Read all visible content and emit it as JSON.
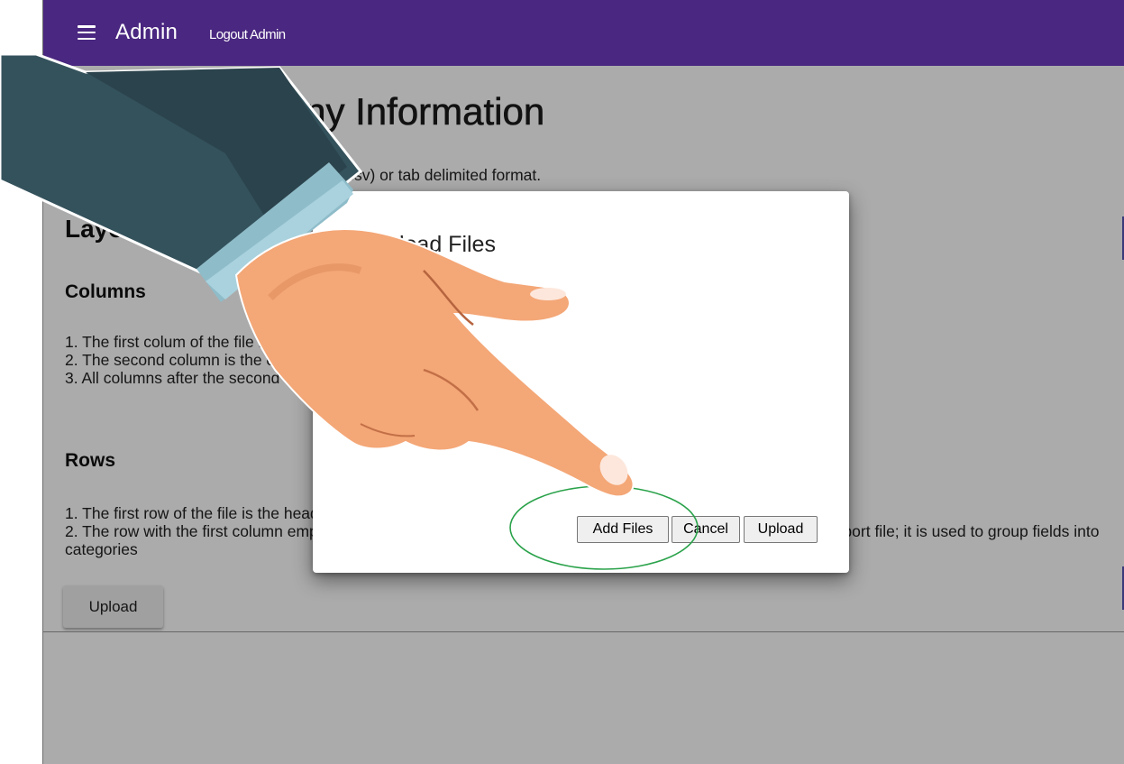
{
  "header": {
    "brand": "Admin",
    "logout": "Logout Admin",
    "accent": "#4a2780"
  },
  "main": {
    "title": "Import Company Information",
    "intro": "Upload a file in either comma delimited (csv) or tab delimited format.",
    "layout_heading": "Layout",
    "columns_heading": "Columns",
    "column_lines": [
      "1. The first colum of the file is the company identifier, this is used to identify the company in later imports.",
      "2. The second column is the company name.",
      "3. All columns after the second column are fields."
    ],
    "rows_heading": "Rows",
    "row_lines": [
      "1. The first row of the file is the header row.",
      "2. The row with the first column empty may appear in any row after the first, and does not have to exist in the import file; it is used to group fields into categories"
    ],
    "upload_button": "Upload"
  },
  "dialog": {
    "title": "Upload Files",
    "add_files": "Add Files",
    "cancel": "Cancel",
    "upload": "Upload"
  },
  "overlay": {
    "highlight_color": "#2aa24a",
    "icon": "pointing-hand-icon"
  }
}
